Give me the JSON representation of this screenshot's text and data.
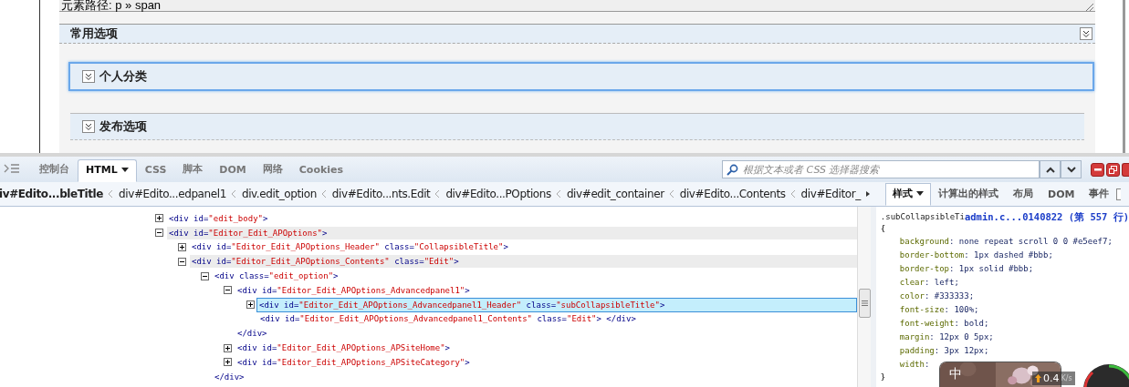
{
  "page": {
    "element_path": "元素路径: p » span",
    "section_title": "常用选项",
    "subpanels": [
      {
        "title": "个人分类",
        "focused": true
      },
      {
        "title": "发布选项",
        "focused": false
      }
    ]
  },
  "devtools": {
    "tabs": [
      {
        "label": "控制台",
        "selected": false,
        "menu": false
      },
      {
        "label": "HTML",
        "selected": true,
        "menu": true
      },
      {
        "label": "CSS",
        "selected": false,
        "menu": false
      },
      {
        "label": "脚本",
        "selected": false,
        "menu": false
      },
      {
        "label": "DOM",
        "selected": false,
        "menu": false
      },
      {
        "label": "网络",
        "selected": false,
        "menu": false
      },
      {
        "label": "Cookies",
        "selected": false,
        "menu": false
      }
    ],
    "search": {
      "placeholder": "根据文本或者 CSS 选择器搜索"
    },
    "side_option": {
      "checked": false
    },
    "breadcrumb": [
      {
        "label": "iv#Edito...bleTitle",
        "selected": true
      },
      {
        "label": "div#Edito...edpanel1",
        "selected": false
      },
      {
        "label": "div.edit_option",
        "selected": false
      },
      {
        "label": "div#Edito...nts.Edit",
        "selected": false
      },
      {
        "label": "div#Edito...POptions",
        "selected": false
      },
      {
        "label": "div#edit_container",
        "selected": false
      },
      {
        "label": "div#Edito...Contents",
        "selected": false
      },
      {
        "label": "div#Editor_",
        "selected": false
      }
    ],
    "side_tabs": [
      {
        "label": "样式",
        "selected": true,
        "menu": true
      },
      {
        "label": "计算出的样式",
        "selected": false,
        "menu": false
      },
      {
        "label": "布局",
        "selected": false,
        "menu": false
      },
      {
        "label": "DOM",
        "selected": false,
        "menu": false
      },
      {
        "label": "事件",
        "selected": false,
        "menu": false
      }
    ],
    "tree": [
      {
        "text": "<div id=\"edit_body\">",
        "expanded": false,
        "shaded": false,
        "selected": false,
        "kind": "node"
      },
      {
        "text": "<div id=\"Editor_Edit_APOptions\">",
        "expanded": true,
        "shaded": true,
        "selected": false,
        "kind": "node",
        "children": [
          {
            "text": "<div id=\"Editor_Edit_APOptions_Header\" class=\"CollapsibleTitle\">",
            "expanded": false,
            "shaded": false,
            "selected": false,
            "kind": "node"
          },
          {
            "text": "<div id=\"Editor_Edit_APOptions_Contents\" class=\"Edit\">",
            "expanded": true,
            "shaded": true,
            "selected": false,
            "kind": "node",
            "children": [
              {
                "text": "<div class=\"edit_option\">",
                "expanded": true,
                "shaded": false,
                "selected": false,
                "kind": "node",
                "close": "</div>",
                "children": [
                  {
                    "text": "<div id=\"Editor_Edit_APOptions_Advancedpanel1\">",
                    "expanded": true,
                    "shaded": false,
                    "selected": false,
                    "kind": "node",
                    "close": "</div>",
                    "children": [
                      {
                        "text": "<div id=\"Editor_Edit_APOptions_Advancedpanel1_Header\" class=\"subCollapsibleTitle\">",
                        "expanded": false,
                        "shaded": false,
                        "selected": true,
                        "kind": "node"
                      },
                      {
                        "text": "<div id=\"Editor_Edit_APOptions_Advancedpanel1_Contents\" class=\"Edit\">  </div>",
                        "selected": false,
                        "shaded": false,
                        "kind": "leaf"
                      }
                    ]
                  },
                  {
                    "text": "<div id=\"Editor_Edit_APOptions_APSiteHome\">",
                    "expanded": false,
                    "shaded": false,
                    "selected": false,
                    "kind": "node"
                  },
                  {
                    "text": "<div id=\"Editor_Edit_APOptions_APSiteCategory\">",
                    "expanded": false,
                    "shaded": false,
                    "selected": false,
                    "kind": "node"
                  }
                ]
              }
            ]
          }
        ]
      }
    ],
    "css_rule": {
      "selector": ".subCollapsibleTi",
      "source": "admin.c...0140822 (第 557 行)",
      "open": "{",
      "lines": [
        "background: none repeat scroll 0 0 #e5eef7;",
        "border-bottom: 1px dashed #bbb;",
        "border-top: 1px solid #bbb;",
        "clear: left;",
        "color: #333333;",
        "font-size: 100%;",
        "font-weight: bold;",
        "margin: 12px 0 5px;",
        "padding: 3px 12px;",
        "width:"
      ],
      "close": "}"
    }
  },
  "overlay": {
    "ime_label": "中",
    "speed": "0.4",
    "speed_unit": "K/s"
  }
}
